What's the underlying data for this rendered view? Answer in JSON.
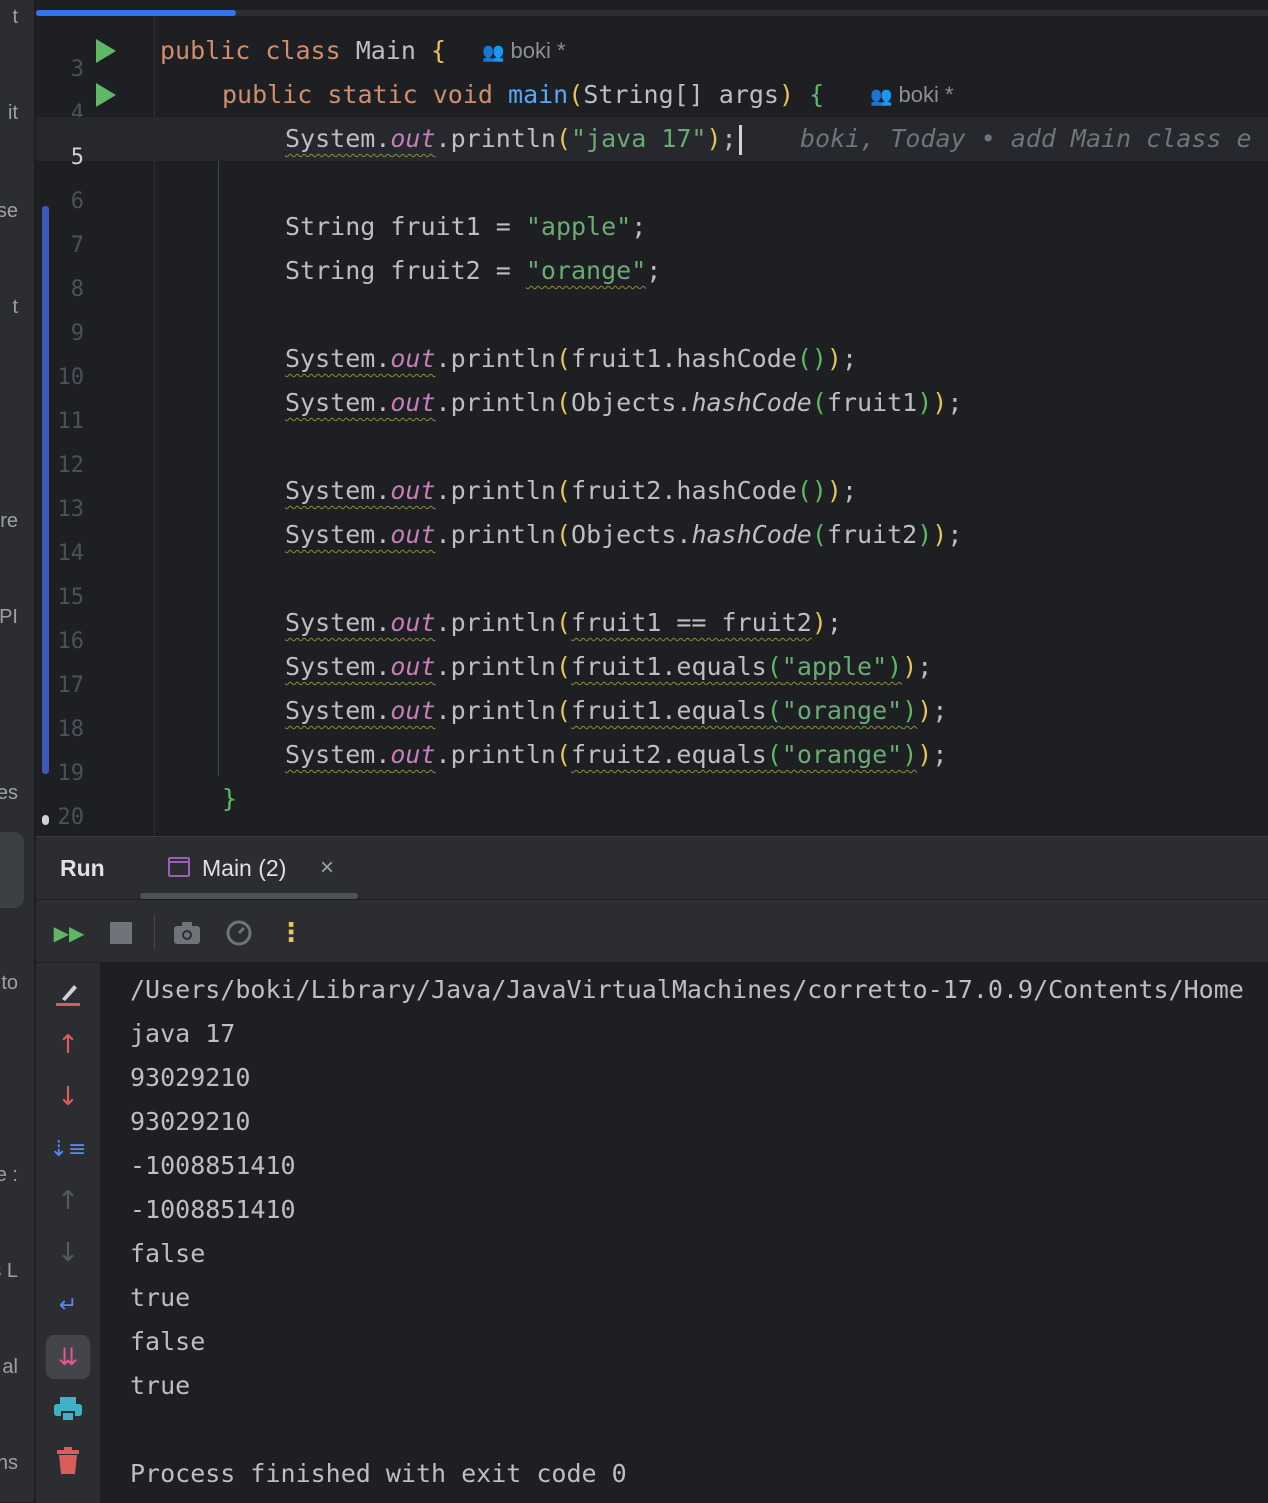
{
  "sidebar_fragments": [
    "t",
    "it",
    "se",
    "t",
    "re",
    "PI",
    "es",
    "to",
    "e :",
    "s L",
    "al",
    "ns"
  ],
  "editor": {
    "active_line": 5,
    "blame_inline": "boki, Today • add Main class e",
    "author_hint": "boki *",
    "lines": [
      {
        "n": "3"
      },
      {
        "n": "4"
      },
      {
        "n": "5"
      },
      {
        "n": "6"
      },
      {
        "n": "7"
      },
      {
        "n": "8"
      },
      {
        "n": "9"
      },
      {
        "n": "10"
      },
      {
        "n": "11"
      },
      {
        "n": "12"
      },
      {
        "n": "13"
      },
      {
        "n": "14"
      },
      {
        "n": "15"
      },
      {
        "n": "16"
      },
      {
        "n": "17"
      },
      {
        "n": "18"
      },
      {
        "n": "19"
      },
      {
        "n": "20"
      }
    ],
    "tokens": {
      "kw_public": "public",
      "kw_class": "class",
      "class_name": " Main ",
      "kw_static": "static",
      "kw_void": "void",
      "method_main": "main",
      "params": "String[] args",
      "kw_string": "String",
      "var_fruit1": "fruit1",
      "var_fruit2": "fruit2",
      "str_java17": "\"java 17\"",
      "str_apple": "\"apple\"",
      "str_orange": "\"orange\"",
      "system": "System",
      "out": "out",
      "println": "println",
      "hashcode": "hashCode",
      "objects": "Objects",
      "equals": "equals"
    }
  },
  "run": {
    "title": "Run",
    "tab_label": "Main (2)",
    "tab_close": "×",
    "console_lines": [
      "/Users/boki/Library/Java/JavaVirtualMachines/corretto-17.0.9/Contents/Home",
      "java 17",
      "93029210",
      "93029210",
      "-1008851410",
      "-1008851410",
      "false",
      "true",
      "false",
      "true",
      "",
      "Process finished with exit code 0"
    ]
  },
  "colors": {
    "accent": "#3574f0",
    "run_green": "#5fb865",
    "error_red": "#db5c5c",
    "keyword": "#cf8e6d",
    "string": "#6aab73",
    "field": "#c77dbb"
  }
}
